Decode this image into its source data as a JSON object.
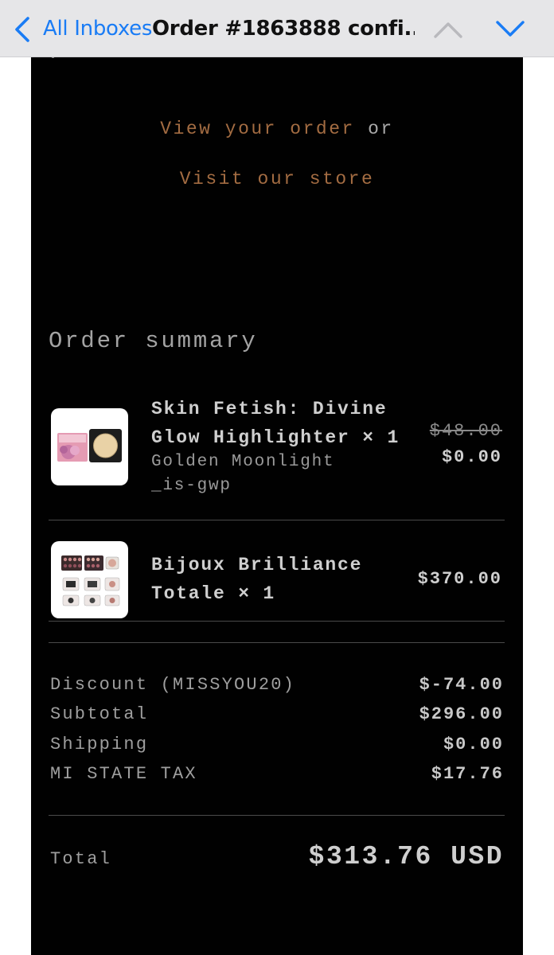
{
  "nav": {
    "back_label": "All Inboxes",
    "title": "Order #1863888 confi...",
    "accent_color": "#1a7cf5"
  },
  "email": {
    "cta": {
      "view_order": "View your order",
      "or": "or",
      "visit_store": "Visit our store"
    },
    "summary_title": "Order summary",
    "items": [
      {
        "name": "Skin Fetish: Divine Glow Highlighter × 1",
        "variant": "Golden Moonlight",
        "tag": "_is-gwp",
        "original_price": "$48.00",
        "price": "$0.00",
        "icon": "highlighter-product-image"
      },
      {
        "name": "Bijoux Brilliance Totale × 1",
        "price": "$370.00",
        "icon": "palette-set-product-image"
      }
    ],
    "totals": [
      {
        "label": "Discount (MISSYOU20)",
        "value": "$-74.00"
      },
      {
        "label": "Subtotal",
        "value": "$296.00"
      },
      {
        "label": "Shipping",
        "value": "$0.00"
      },
      {
        "label": "MI STATE TAX",
        "value": "$17.76"
      }
    ],
    "total": {
      "label": "Total",
      "value": "$313.76 USD"
    },
    "colors": {
      "background": "#010101",
      "link": "#a36c42"
    }
  }
}
